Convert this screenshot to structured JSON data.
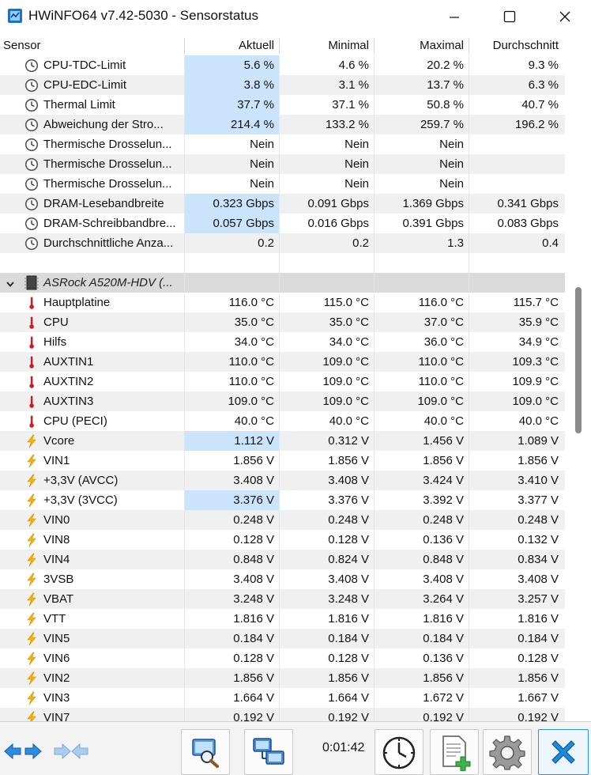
{
  "window": {
    "title": "HWiNFO64 v7.42-5030 - Sensorstatus"
  },
  "columns": {
    "sensor": "Sensor",
    "current": "Aktuell",
    "min": "Minimal",
    "max": "Maximal",
    "avg": "Durchschnitt"
  },
  "rows": [
    {
      "kind": "sensor",
      "icon": "clock-icon",
      "name": "CPU-TDC-Limit",
      "current": "5.6 %",
      "min": "4.6 %",
      "max": "20.2 %",
      "avg": "9.3 %",
      "highlight": true
    },
    {
      "kind": "sensor",
      "icon": "clock-icon",
      "name": "CPU-EDC-Limit",
      "current": "3.8 %",
      "min": "3.1 %",
      "max": "13.7 %",
      "avg": "6.3 %",
      "highlight": true
    },
    {
      "kind": "sensor",
      "icon": "clock-icon",
      "name": "Thermal Limit",
      "current": "37.7 %",
      "min": "37.1 %",
      "max": "50.8 %",
      "avg": "40.7 %",
      "highlight": true
    },
    {
      "kind": "sensor",
      "icon": "clock-icon",
      "name": "Abweichung der Stro...",
      "current": "214.4 %",
      "min": "133.2 %",
      "max": "259.7 %",
      "avg": "196.2 %",
      "highlight": true
    },
    {
      "kind": "sensor",
      "icon": "clock-icon",
      "name": "Thermische Drosselun...",
      "current": "Nein",
      "min": "Nein",
      "max": "Nein",
      "avg": "",
      "highlight": false
    },
    {
      "kind": "sensor",
      "icon": "clock-icon",
      "name": "Thermische Drosselun...",
      "current": "Nein",
      "min": "Nein",
      "max": "Nein",
      "avg": "",
      "highlight": false
    },
    {
      "kind": "sensor",
      "icon": "clock-icon",
      "name": "Thermische Drosselun...",
      "current": "Nein",
      "min": "Nein",
      "max": "Nein",
      "avg": "",
      "highlight": false
    },
    {
      "kind": "sensor",
      "icon": "clock-icon",
      "name": "DRAM-Lesebandbreite",
      "current": "0.323 Gbps",
      "min": "0.091 Gbps",
      "max": "1.369 Gbps",
      "avg": "0.341 Gbps",
      "highlight": true
    },
    {
      "kind": "sensor",
      "icon": "clock-icon",
      "name": "DRAM-Schreibbandbre...",
      "current": "0.057 Gbps",
      "min": "0.016 Gbps",
      "max": "0.391 Gbps",
      "avg": "0.083 Gbps",
      "highlight": true
    },
    {
      "kind": "sensor",
      "icon": "clock-icon",
      "name": "Durchschnittliche Anza...",
      "current": "0.2",
      "min": "0.2",
      "max": "1.3",
      "avg": "0.4",
      "highlight": false
    },
    {
      "kind": "empty"
    },
    {
      "kind": "section",
      "name": "ASRock A520M-HDV (..."
    },
    {
      "kind": "sensor",
      "icon": "thermometer-icon",
      "name": "Hauptplatine",
      "current": "116.0 °C",
      "min": "115.0 °C",
      "max": "116.0 °C",
      "avg": "115.7 °C",
      "highlight": false
    },
    {
      "kind": "sensor",
      "icon": "thermometer-icon",
      "name": "CPU",
      "current": "35.0 °C",
      "min": "35.0 °C",
      "max": "37.0 °C",
      "avg": "35.9 °C",
      "highlight": false
    },
    {
      "kind": "sensor",
      "icon": "thermometer-icon",
      "name": "Hilfs",
      "current": "34.0 °C",
      "min": "34.0 °C",
      "max": "36.0 °C",
      "avg": "34.9 °C",
      "highlight": false
    },
    {
      "kind": "sensor",
      "icon": "thermometer-icon",
      "name": "AUXTIN1",
      "current": "110.0 °C",
      "min": "109.0 °C",
      "max": "110.0 °C",
      "avg": "109.3 °C",
      "highlight": false
    },
    {
      "kind": "sensor",
      "icon": "thermometer-icon",
      "name": "AUXTIN2",
      "current": "110.0 °C",
      "min": "109.0 °C",
      "max": "110.0 °C",
      "avg": "109.9 °C",
      "highlight": false
    },
    {
      "kind": "sensor",
      "icon": "thermometer-icon",
      "name": "AUXTIN3",
      "current": "109.0 °C",
      "min": "109.0 °C",
      "max": "109.0 °C",
      "avg": "109.0 °C",
      "highlight": false
    },
    {
      "kind": "sensor",
      "icon": "thermometer-icon",
      "name": "CPU (PECI)",
      "current": "40.0 °C",
      "min": "40.0 °C",
      "max": "40.0 °C",
      "avg": "40.0 °C",
      "highlight": false
    },
    {
      "kind": "sensor",
      "icon": "lightning-icon",
      "name": "Vcore",
      "current": "1.112 V",
      "min": "0.312 V",
      "max": "1.456 V",
      "avg": "1.089 V",
      "highlight": true
    },
    {
      "kind": "sensor",
      "icon": "lightning-icon",
      "name": "VIN1",
      "current": "1.856 V",
      "min": "1.856 V",
      "max": "1.856 V",
      "avg": "1.856 V",
      "highlight": false
    },
    {
      "kind": "sensor",
      "icon": "lightning-icon",
      "name": "+3,3V (AVCC)",
      "current": "3.408 V",
      "min": "3.408 V",
      "max": "3.424 V",
      "avg": "3.410 V",
      "highlight": false
    },
    {
      "kind": "sensor",
      "icon": "lightning-icon",
      "name": "+3,3V (3VCC)",
      "current": "3.376 V",
      "min": "3.376 V",
      "max": "3.392 V",
      "avg": "3.377 V",
      "highlight": true
    },
    {
      "kind": "sensor",
      "icon": "lightning-icon",
      "name": "VIN0",
      "current": "0.248 V",
      "min": "0.248 V",
      "max": "0.248 V",
      "avg": "0.248 V",
      "highlight": false
    },
    {
      "kind": "sensor",
      "icon": "lightning-icon",
      "name": "VIN8",
      "current": "0.128 V",
      "min": "0.128 V",
      "max": "0.136 V",
      "avg": "0.132 V",
      "highlight": false
    },
    {
      "kind": "sensor",
      "icon": "lightning-icon",
      "name": "VIN4",
      "current": "0.848 V",
      "min": "0.824 V",
      "max": "0.848 V",
      "avg": "0.834 V",
      "highlight": false
    },
    {
      "kind": "sensor",
      "icon": "lightning-icon",
      "name": "3VSB",
      "current": "3.408 V",
      "min": "3.408 V",
      "max": "3.408 V",
      "avg": "3.408 V",
      "highlight": false
    },
    {
      "kind": "sensor",
      "icon": "lightning-icon",
      "name": "VBAT",
      "current": "3.248 V",
      "min": "3.248 V",
      "max": "3.264 V",
      "avg": "3.257 V",
      "highlight": false
    },
    {
      "kind": "sensor",
      "icon": "lightning-icon",
      "name": "VTT",
      "current": "1.816 V",
      "min": "1.816 V",
      "max": "1.816 V",
      "avg": "1.816 V",
      "highlight": false
    },
    {
      "kind": "sensor",
      "icon": "lightning-icon",
      "name": "VIN5",
      "current": "0.184 V",
      "min": "0.184 V",
      "max": "0.184 V",
      "avg": "0.184 V",
      "highlight": false
    },
    {
      "kind": "sensor",
      "icon": "lightning-icon",
      "name": "VIN6",
      "current": "0.128 V",
      "min": "0.128 V",
      "max": "0.136 V",
      "avg": "0.128 V",
      "highlight": false
    },
    {
      "kind": "sensor",
      "icon": "lightning-icon",
      "name": "VIN2",
      "current": "1.856 V",
      "min": "1.856 V",
      "max": "1.856 V",
      "avg": "1.856 V",
      "highlight": false
    },
    {
      "kind": "sensor",
      "icon": "lightning-icon",
      "name": "VIN3",
      "current": "1.664 V",
      "min": "1.664 V",
      "max": "1.672 V",
      "avg": "1.667 V",
      "highlight": false
    },
    {
      "kind": "sensor",
      "icon": "lightning-icon",
      "name": "VIN7",
      "current": "0.192 V",
      "min": "0.192 V",
      "max": "0.192 V",
      "avg": "0.192 V",
      "highlight": false
    }
  ],
  "toolbar": {
    "timer": "0:01:42"
  },
  "colors": {
    "highlight": "#cce4fb",
    "alt_row": "#f0f0f0",
    "section_row": "#dadada",
    "thermometer": "#c8202a",
    "lightning": "#f5b400",
    "close_accent": "#1f8ad6"
  }
}
